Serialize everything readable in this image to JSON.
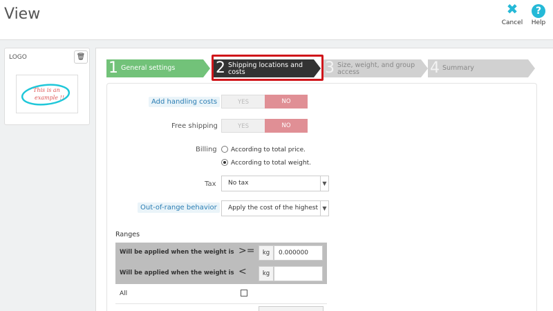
{
  "header": {
    "title": "View",
    "toolbar": {
      "cancel_label": "Cancel",
      "cancel_icon": "✖",
      "help_label": "Help",
      "help_icon": "?"
    }
  },
  "logo_panel": {
    "label": "LOGO",
    "delete_icon": "🗑",
    "preview_text_line1": "This is an",
    "preview_text_line2": "example !!"
  },
  "wizard": {
    "steps": [
      {
        "number": "1",
        "label": "General settings",
        "state": "done"
      },
      {
        "number": "2",
        "label": "Shipping locations and costs",
        "state": "active"
      },
      {
        "number": "3",
        "label": "Size, weight, and group access",
        "state": "todo"
      },
      {
        "number": "4",
        "label": "Summary",
        "state": "todo"
      }
    ]
  },
  "form": {
    "handling_costs": {
      "label": "Add handling costs",
      "yes": "YES",
      "no": "NO",
      "value": "NO"
    },
    "free_shipping": {
      "label": "Free shipping",
      "yes": "YES",
      "no": "NO",
      "value": "NO"
    },
    "billing": {
      "label": "Billing",
      "options": [
        "According to total price.",
        "According to total weight."
      ],
      "selected": "According to total weight."
    },
    "tax": {
      "label": "Tax",
      "value": "No tax"
    },
    "out_of_range": {
      "label": "Out-of-range behavior",
      "value": "Apply the cost of the highest"
    }
  },
  "ranges": {
    "title": "Ranges",
    "rows": [
      {
        "label": "Will be applied when the weight is",
        "operator": ">=",
        "unit": "kg",
        "value": "0.000000"
      },
      {
        "label": "Will be applied when the weight is",
        "operator": "<",
        "unit": "kg",
        "value": ""
      }
    ],
    "all_label": "All"
  },
  "colors": {
    "accent": "#25b9d7",
    "step_done": "#72c279",
    "step_active": "#333333",
    "step_todo": "#d1d1d1",
    "switch_no": "#e08f95",
    "highlight": "#d0151a"
  }
}
